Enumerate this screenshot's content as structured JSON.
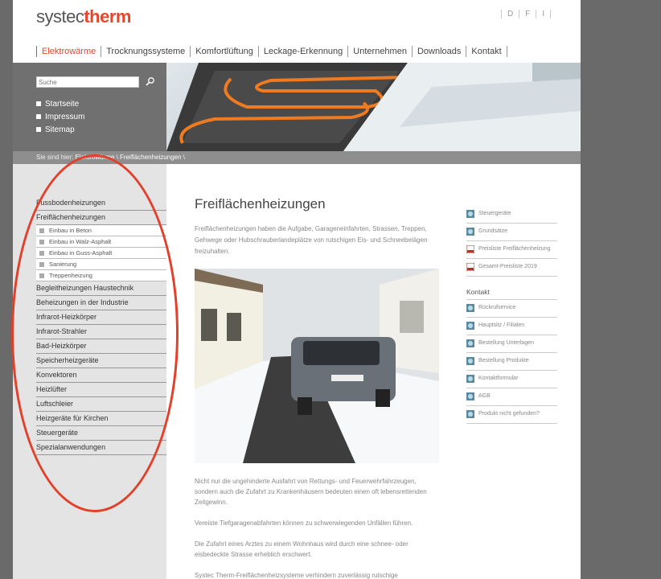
{
  "logo": {
    "part1": "systec",
    "part2": "therm"
  },
  "lang": [
    "D",
    "F",
    "I"
  ],
  "mainnav": [
    "Elektrowärme",
    "Trocknungssysteme",
    "Komfortlüftung",
    "Leckage-Erkennung",
    "Unternehmen",
    "Downloads",
    "Kontakt"
  ],
  "search": {
    "placeholder": "Suche"
  },
  "quicklinks": [
    "Startseite",
    "Impressum",
    "Sitemap"
  ],
  "breadcrumb": {
    "prefix": "Sie sind hier: ",
    "level1": "Elektrowärme",
    "sep": " \\ ",
    "level2": "Freiflächenheizungen",
    "end": " \\"
  },
  "sidenav": {
    "items": [
      "Fussbodenheizungen",
      "Freiflächenheizungen"
    ],
    "subitems": [
      "Einbau in Beton",
      "Einbau in Walz-Asphalt",
      "Einbau in Guss-Asphalt",
      "Sanierung",
      "Treppenheizung"
    ],
    "items2": [
      "Begleitheizungen Haustechnik",
      "Beheizungen in der Industrie",
      "Infrarot-Heizkörper",
      "Infrarot-Strahler",
      "Bad-Heizkörper",
      "Speicherheizgeräte",
      "Konvektoren",
      "Heizlüfter",
      "Luftschleier",
      "Heizgeräte für Kirchen",
      "Steuergeräte",
      "Spezialanwendungen"
    ]
  },
  "main": {
    "title": "Freiflächenheizungen",
    "intro": "Freiflächenheizungen haben die Aufgabe, Garageneinfahrten, Strassen, Treppen, Gehwege oder Hubschrauberlandeplätze von rutschigen Eis- und Schneebelägen freizuhalten.",
    "p1": "Nicht nur die ungehinderte Ausfahrt von Rettungs- und Feuerwehrfahrzeugen, sondern auch die Zufahrt zu Krankenhäusern bedeuten einen oft lebensrettenden Zeitgewinn.",
    "p2": "Vereiste Tiefgaragenabfahrten können zu schwerwiegenden Unfällen führen.",
    "p3": "Die Zufahrt eines Arztes zu einem Wohnhaus wird durch eine schnee- oder eisbedeckte Strasse erheblich erschwert.",
    "p4": "Systec Therm-Freiflächenheizsysteme verhindern zuverlässig rutschige"
  },
  "right": {
    "links": [
      "Steuergeräte",
      "Grundsätze",
      "Preisliste Freiflächenheizung",
      "Gesamt-Preisliste 2019"
    ],
    "contact_title": "Kontakt",
    "contact_links": [
      "Rückrufservice",
      "Hauptsitz / Filialen",
      "Bestellung Unterlagen",
      "Bestellung Produkte",
      "Kontaktformular",
      "AGB",
      "Produkt nicht gefunden?"
    ]
  },
  "colors": {
    "accent": "#e8452c",
    "nav_dark": "#707070",
    "sidebar": "#e4e4e4",
    "annotation": "#e2402b"
  }
}
